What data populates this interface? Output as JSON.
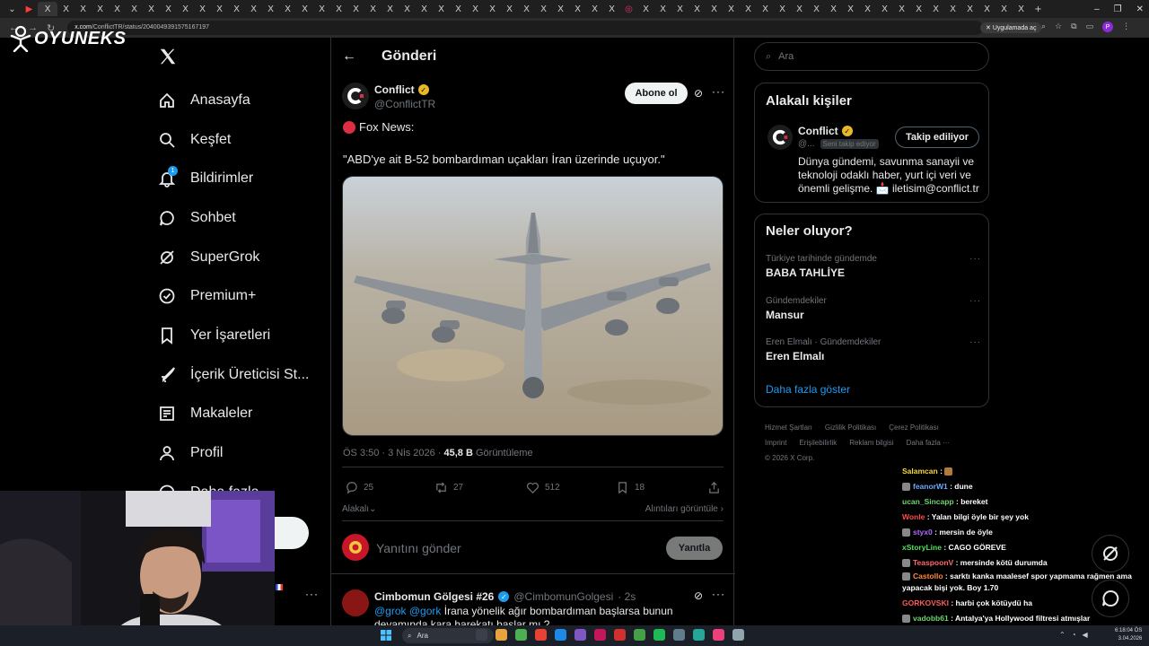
{
  "browser": {
    "url_host": "x.com",
    "url_path": "/ConflictTR/status/2040049391575167197",
    "extension_label": "Uygulamada aç",
    "profile_initial": "P"
  },
  "watermark": {
    "brand": "OYUNEKS"
  },
  "sidebar": {
    "items": [
      {
        "label": "Anasayfa",
        "icon": "home-icon"
      },
      {
        "label": "Keşfet",
        "icon": "search-icon"
      },
      {
        "label": "Bildirimler",
        "icon": "bell-icon",
        "badge": "1"
      },
      {
        "label": "Sohbet",
        "icon": "chat-icon"
      },
      {
        "label": "SuperGrok",
        "icon": "grok-icon"
      },
      {
        "label": "Premium+",
        "icon": "verified-badge-icon"
      },
      {
        "label": "Yer İşaretleri",
        "icon": "bookmark-icon"
      },
      {
        "label": "İçerik Üreticisi St...",
        "icon": "rocket-icon"
      },
      {
        "label": "Makaleler",
        "icon": "article-icon"
      },
      {
        "label": "Profil",
        "icon": "person-icon"
      },
      {
        "label": "Daha fazla",
        "icon": "more-circle-icon"
      }
    ]
  },
  "post": {
    "header_title": "Gönderi",
    "author_name": "Conflict",
    "author_handle": "@ConflictTR",
    "subscribe_label": "Abone ol",
    "source_line": "Fox News:",
    "quote": "\"ABD'ye ait B-52 bombardıman uçakları İran üzerinde uçuyor.\"",
    "time": "ÖS 3:50 · 3 Nis 2026 · ",
    "views_value": "45,8 B",
    "views_label": " Görüntüleme",
    "replies": "25",
    "reposts": "27",
    "likes": "512",
    "bookmarks": "18",
    "sort_left": "Alakalı",
    "sort_right": "Alıntıları görüntüle",
    "reply_placeholder": "Yanıtını gönder",
    "reply_button": "Yanıtla"
  },
  "comment": {
    "name": "Cimbomun Gölgesi #26",
    "handle": "@CimbomunGolgesi",
    "age": "· 2s",
    "mention1": "@grok",
    "mention2": "@gork",
    "text": " İrana yönelik ağır bombardıman başlarsa bunun devamında kara harekatı başlar mı ?"
  },
  "right": {
    "search_placeholder": "Ara",
    "related_title": "Alakalı kişiler",
    "rel_name": "Conflict",
    "rel_handle": "@...",
    "rel_follows_you": "Seni takip ediyor",
    "rel_follow_btn": "Takip ediliyor",
    "rel_bio": "Dünya gündemi, savunma sanayii ve teknoloji odaklı haber, yurt içi veri ve önemli gelişme. 📩 iletisim@conflict.tr",
    "trends_title": "Neler oluyor?",
    "trends": [
      {
        "category": "Türkiye tarihinde gündemde",
        "title": "BABA TAHLİYE"
      },
      {
        "category": "Gündemdekiler",
        "title": "Mansur"
      },
      {
        "category": "Eren Elmalı · Gündemdekiler",
        "title": "Eren Elmalı"
      }
    ],
    "show_more": "Daha fazla göster",
    "footer": [
      "Hizmet Şartları",
      "Gizlilik Politikası",
      "Çerez Politikası",
      "Imprint",
      "Erişilebilirlik",
      "Reklam bilgisi",
      "Daha fazla ···",
      "© 2026 X Corp."
    ]
  },
  "chat": [
    {
      "user": "Salamcan",
      "text": ": ",
      "color": "#f5d742",
      "emote": true
    },
    {
      "user": "feanorW1",
      "text": ": dune",
      "color": "#6aa9ff",
      "badge": true
    },
    {
      "user": "ucan_Sincapp",
      "text": ": bereket",
      "color": "#6fd36f"
    },
    {
      "user": "Wonle",
      "text": ": Yalan bilgi öyle bir şey yok",
      "color": "#ff4a4a"
    },
    {
      "user": "styx0",
      "text": ": mersin de öyle",
      "color": "#b46aff",
      "badge": true
    },
    {
      "user": "xStoryLine",
      "text": ": CAGO GÖREVE",
      "color": "#53e05a"
    },
    {
      "user": "TeaspoonV",
      "text": ": mersinde kötü durumda",
      "color": "#ff6a6a",
      "badge": true
    },
    {
      "user": "Castollo",
      "text": ": sarktı kanka maalesef spor yapmama rağmen ama yapacak bişi yok. Boy 1.70",
      "color": "#ff8a3a",
      "badge": true,
      "wrap": true
    },
    {
      "user": "GORKOVSKI",
      "text": ": harbi çok kötüydü ha",
      "color": "#ff5a5a"
    },
    {
      "user": "vadobb61",
      "text": ": Antalya'ya Hollywood filtresi atmışlar",
      "color": "#6fd36f",
      "badge": true
    },
    {
      "user": "thinkingvoice",
      "text": ": ",
      "color": "#c7c7ff",
      "emote": true
    }
  ],
  "taskbar": {
    "search_label": "Ara",
    "time": "6:18:04 ÖS",
    "date": "3.04.2026"
  },
  "colors": {
    "accent": "#1d9bf0",
    "gold_verified": "#e8b829",
    "background": "#000000"
  }
}
